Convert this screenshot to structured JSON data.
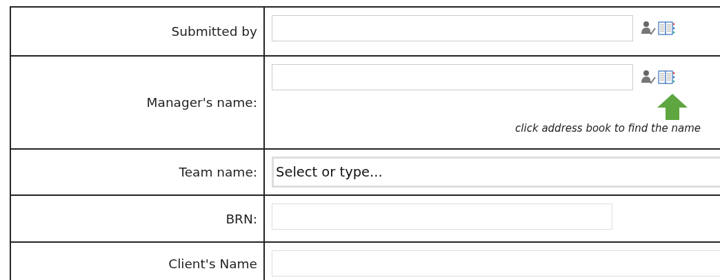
{
  "rows": [
    {
      "label": "Submitted by",
      "field": {
        "kind": "people"
      }
    },
    {
      "label": "Manager's name:",
      "field": {
        "kind": "people",
        "hint": "click address book to find the name"
      }
    },
    {
      "label": "Team name:",
      "field": {
        "kind": "combo",
        "placeholder": "Select or type..."
      }
    },
    {
      "label": "BRN:",
      "field": {
        "kind": "text"
      }
    },
    {
      "label": "Client's Name",
      "field": {
        "kind": "text_wide"
      }
    }
  ]
}
